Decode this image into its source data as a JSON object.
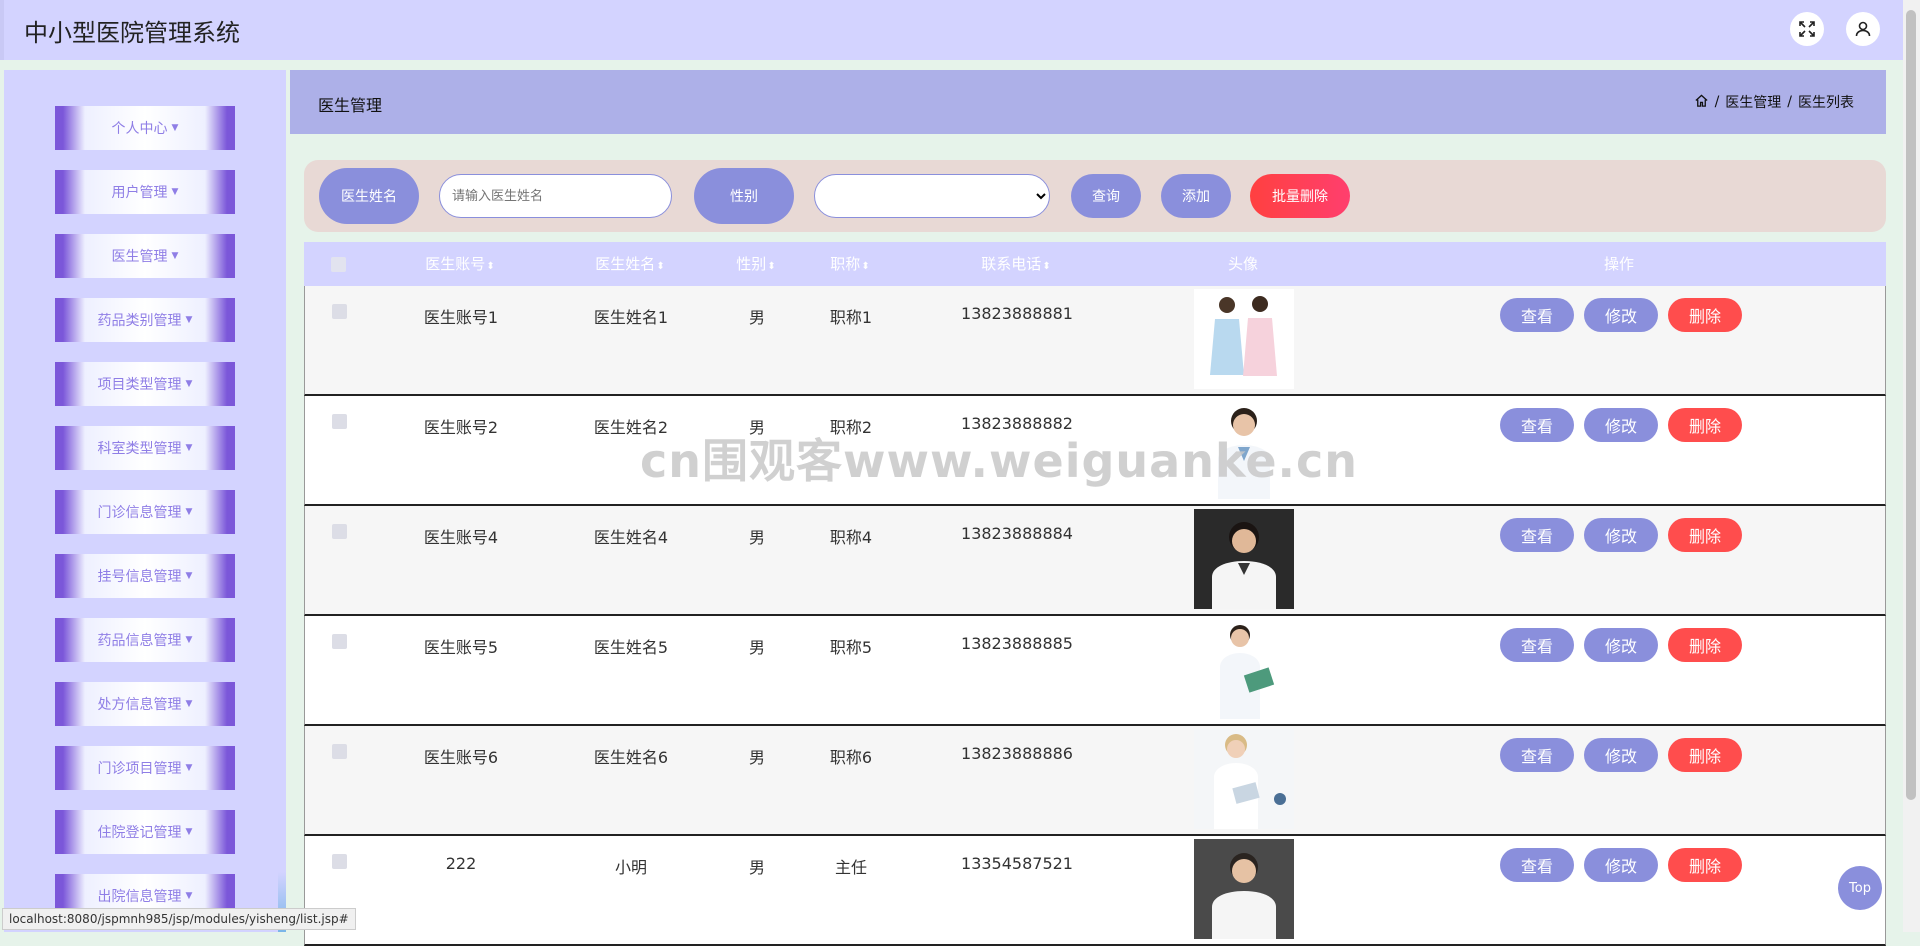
{
  "app": {
    "title": "中小型医院管理系统"
  },
  "header": {
    "fullscreen_icon": "fullscreen-icon",
    "user_icon": "user-icon"
  },
  "sidebar": {
    "items": [
      {
        "label": "个人中心"
      },
      {
        "label": "用户管理"
      },
      {
        "label": "医生管理"
      },
      {
        "label": "药品类别管理"
      },
      {
        "label": "项目类型管理"
      },
      {
        "label": "科室类型管理"
      },
      {
        "label": "门诊信息管理"
      },
      {
        "label": "挂号信息管理"
      },
      {
        "label": "药品信息管理"
      },
      {
        "label": "处方信息管理"
      },
      {
        "label": "门诊项目管理"
      },
      {
        "label": "住院登记管理"
      },
      {
        "label": "出院信息管理"
      }
    ],
    "caret": "▼"
  },
  "page": {
    "title": "医生管理",
    "breadcrumb": {
      "sep": "/",
      "level1": "医生管理",
      "level2": "医生列表"
    }
  },
  "filters": {
    "name_label": "医生姓名",
    "name_placeholder": "请输入医生姓名",
    "gender_label": "性别",
    "search_label": "查询",
    "add_label": "添加",
    "batch_delete_label": "批量删除"
  },
  "table": {
    "columns": {
      "account": "医生账号",
      "name": "医生姓名",
      "gender": "性别",
      "title": "职称",
      "phone": "联系电话",
      "avatar": "头像",
      "actions": "操作"
    },
    "sort_icon": "⬍",
    "actions": {
      "view": "查看",
      "edit": "修改",
      "delete": "删除"
    },
    "rows": [
      {
        "account": "医生账号1",
        "name": "医生姓名1",
        "gender": "男",
        "title": "职称1",
        "phone": "13823888881"
      },
      {
        "account": "医生账号2",
        "name": "医生姓名2",
        "gender": "男",
        "title": "职称2",
        "phone": "13823888882"
      },
      {
        "account": "医生账号4",
        "name": "医生姓名4",
        "gender": "男",
        "title": "职称4",
        "phone": "13823888884"
      },
      {
        "account": "医生账号5",
        "name": "医生姓名5",
        "gender": "男",
        "title": "职称5",
        "phone": "13823888885"
      },
      {
        "account": "医生账号6",
        "name": "医生姓名6",
        "gender": "男",
        "title": "职称6",
        "phone": "13823888886"
      },
      {
        "account": "222",
        "name": "小明",
        "gender": "男",
        "title": "主任",
        "phone": "13354587521"
      }
    ]
  },
  "watermark": "cn围观客www.weiguanke.cn",
  "status_bar": {
    "url": "localhost:8080/jspmnh985/jsp/modules/yisheng/list.jsp#"
  },
  "back_to_top": "Top",
  "colors": {
    "accent": "#8a8fdc",
    "header": "#d3d3ff",
    "content_header": "#adb0e8",
    "danger": "#ff4d4d",
    "sidebar_border": "#7b57d9"
  }
}
